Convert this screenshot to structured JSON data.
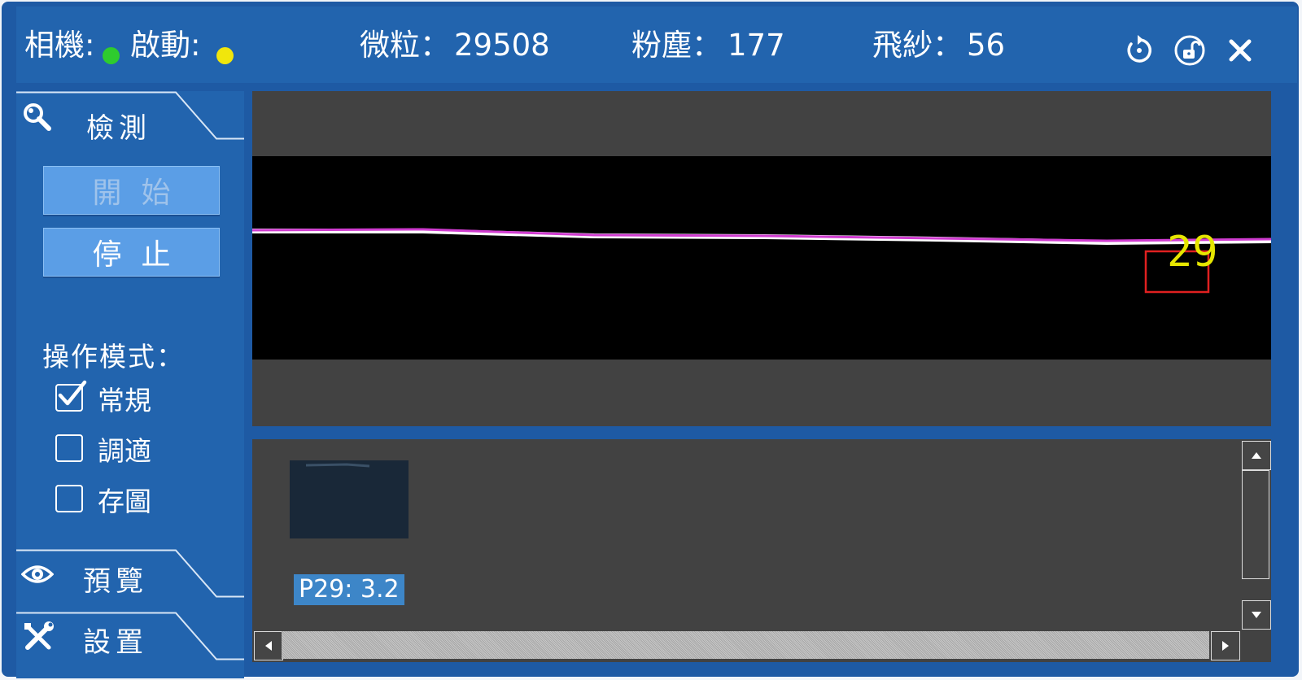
{
  "status_bar": {
    "camera_label": "相機:",
    "camera_color": "#2ecc2e",
    "start_label": "啟動:",
    "start_color": "#f1e60c",
    "particles_label": "微粒：",
    "particles_value": "29508",
    "dust_label": "粉塵：",
    "dust_value": "177",
    "yarn_label": "飛紗：",
    "yarn_value": "56",
    "icons": [
      "refresh-icon",
      "unlock-icon",
      "close-icon"
    ]
  },
  "sidebar": {
    "detect_tab": {
      "label": "檢測",
      "icon": "search-icon"
    },
    "start_button": "開始",
    "stop_button": "停止",
    "mode_title": "操作模式：",
    "modes": [
      {
        "label": "常規",
        "checked": true
      },
      {
        "label": "調適",
        "checked": false
      },
      {
        "label": "存圖",
        "checked": false
      }
    ],
    "preview_tab": {
      "label": "預覽",
      "icon": "eye-icon"
    },
    "settings_tab": {
      "label": "設置",
      "icon": "tools-icon"
    }
  },
  "camera_view": {
    "detection_label": "29",
    "detection_color": "#e6e600",
    "box_color": "#e02020",
    "line_color": "#d03cd0"
  },
  "thumbnails": [
    {
      "caption": "P29: 3.2"
    }
  ],
  "colors": {
    "frame": "#1e5aa4",
    "panel": "#2264ae",
    "button": "#5b9ee6",
    "viewer_bg": "#424242"
  }
}
